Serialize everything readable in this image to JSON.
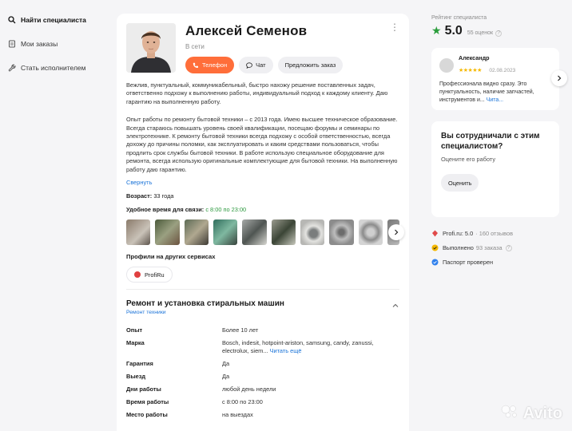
{
  "sidebar": {
    "items": [
      {
        "label": "Найти специалиста",
        "icon": "search-icon",
        "active": true
      },
      {
        "label": "Мои заказы",
        "icon": "orders-icon",
        "active": false
      },
      {
        "label": "Стать исполнителем",
        "icon": "wrench-icon",
        "active": false
      }
    ]
  },
  "profile": {
    "name": "Алексей Семенов",
    "status": "В сети",
    "buttons": {
      "phone": "Телефон",
      "chat": "Чат",
      "order": "Предложить заказ"
    },
    "intro": "Вежлив, пунктуальный, коммуникабельный, быстро нахожу решение поставленных задач, ответственно подхожу к выполнению работы, индивидуальный подход к каждому клиенту. Даю гарантию на выполненную работу.",
    "about": "Опыт работы по ремонту бытовой техники – с 2013 года. Имею высшее техническое образование. Всегда стараюсь повышать уровень своей квалификации, посещаю форумы и семинары по электротехнике. К ремонту бытовой техники всегда подхожу с особой ответственностью, всегда дохожу до причины поломки, как эксплуатировать и каким средствами пользоваться, чтобы продлить срок службы бытовой техники. В работе использую специальное оборудование для ремонта, всегда использую оригинальные комплектующие для бытовой техники. На выполненную работу даю гарантию.",
    "collapse_link": "Свернуть",
    "age_label": "Возраст:",
    "age_value": "33 года",
    "time_label": "Удобное время для связи:",
    "time_value": "с 8:00 по 23:00",
    "profiles_title": "Профили на других сервисах",
    "profi_chip": "ProfiRu"
  },
  "service": {
    "title": "Ремонт и установка стиральных машин",
    "subtitle": "Ремонт техники",
    "rows": [
      {
        "key": "Опыт",
        "value": "Более 10 лет"
      },
      {
        "key": "Марка",
        "value": "Bosch, indesit, hotpoint-ariston, samsung, candy, zanussi, electrolux, siem...",
        "more": "Читать ещё"
      },
      {
        "key": "Гарантия",
        "value": "Да"
      },
      {
        "key": "Выезд",
        "value": "Да"
      },
      {
        "key": "Дни работы",
        "value": "любой день недели"
      },
      {
        "key": "Время работы",
        "value": "с 8:00 по 23:00"
      },
      {
        "key": "Место работы",
        "value": "на выездах"
      }
    ]
  },
  "rating": {
    "label": "Рейтинг специалиста",
    "value": "5.0",
    "count": "55 оценок",
    "star_color": "#2a9d3b"
  },
  "review": {
    "author": "Александр",
    "stars": "★★★★★",
    "date": "02.08.2023",
    "text": "Профессионала видно сразу. Это пунктуальность, наличие запчастей, инструментов и...",
    "more": "Чита..."
  },
  "collab": {
    "title": "Вы сотрудничали с этим специалистом?",
    "subtitle": "Оцените его работу",
    "button": "Оценить"
  },
  "facts": [
    {
      "text": "Profi.ru: 5.0",
      "muted": "· 160 отзывов",
      "icon": "profi-icon"
    },
    {
      "text": "Выполнено",
      "muted": "93 заказа",
      "icon": "done-icon",
      "info": true
    },
    {
      "text": "Паспорт проверен",
      "muted": "",
      "icon": "passport-check-icon"
    }
  ],
  "watermark": "Avito",
  "colors": {
    "accent": "#ff6e3a",
    "link": "#1a73d8",
    "green": "#2e9a40",
    "bg": "#f5f5f7"
  }
}
